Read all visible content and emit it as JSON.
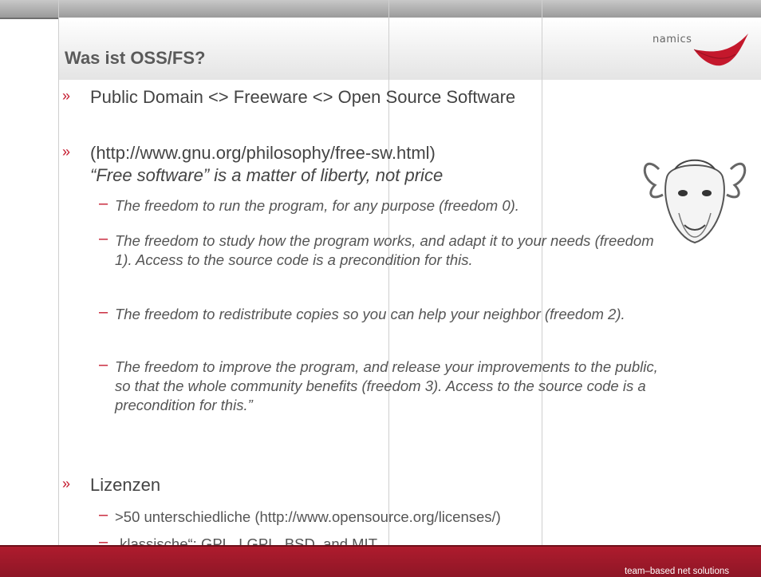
{
  "slide": {
    "title": "Was ist OSS/FS?",
    "logo_text": "namics",
    "footer_text": "team–based net solutions",
    "bullets": {
      "b1": "Public Domain <> Freeware <> Open Source Software",
      "b2_line1": "(http://www.gnu.org/philosophy/free-sw.html)",
      "b2_line2": "“Free software” is a matter of liberty, not price",
      "b3": "Lizenzen"
    },
    "freedoms": {
      "f0": "The freedom to run the program, for any purpose (freedom 0).",
      "f1": "The freedom to study how the program works, and adapt it to your needs (freedom 1). Access to the source code is a precondition for this.",
      "f2": "The freedom to redistribute copies so you can help your neighbor (freedom 2).",
      "f3": "The freedom to improve the program, and release your improvements to the public, so that the whole community benefits (freedom 3). Access to the source code is a precondition for this.”"
    },
    "licenses": {
      "l1": ">50 unterschiedliche (http://www.opensource.org/licenses/)",
      "l2": "„klassische“: GPL, LGPL, BSD, and MIT"
    },
    "colors": {
      "accent": "#c4182c",
      "footer": "#a31a2b"
    }
  }
}
